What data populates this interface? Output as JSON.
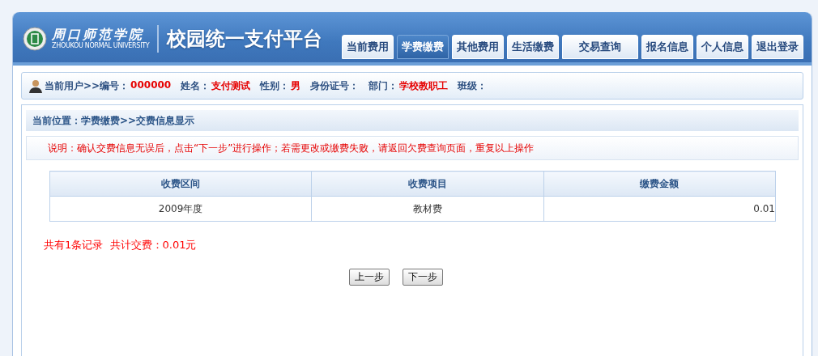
{
  "header": {
    "school_name": "周口师范学院",
    "school_name_en": "ZHOUKOU NORMAL UNIVERSITY",
    "title": "校园统一支付平台"
  },
  "nav": [
    {
      "label": "当前费用",
      "selected": false
    },
    {
      "label": "学费缴费",
      "selected": true
    },
    {
      "label": "其他费用",
      "selected": false
    },
    {
      "label": "生活缴费",
      "selected": false
    },
    {
      "label": "交易查询",
      "selected": false
    },
    {
      "label": "报名信息",
      "selected": false
    },
    {
      "label": "个人信息",
      "selected": false
    },
    {
      "label": "退出登录",
      "selected": false
    }
  ],
  "user_info": [
    {
      "label": "当前用户>>编号：",
      "value": "000000"
    },
    {
      "label": "姓名：",
      "value": "支付测试"
    },
    {
      "label": "性别：",
      "value": "男"
    },
    {
      "label": "身份证号："
    },
    {
      "label": "部门：",
      "value": "学校教职工"
    },
    {
      "label": "班级："
    }
  ],
  "breadcrumb": "当前位置：学费缴费>>交费信息显示",
  "notice": "说明：确认交费信息无误后，点击“下一步”进行操作；若需更改或缴费失败，请返回欠费查询页面，重复以上操作",
  "table": {
    "columns": [
      "收费区间",
      "收费项目",
      "缴费金额"
    ],
    "rows": [
      [
        "2009年度",
        "教材费",
        "0.01"
      ]
    ]
  },
  "summary": "共有1条记录  共计交费：0.01元",
  "buttons": [
    "上一步",
    "下一步"
  ]
}
